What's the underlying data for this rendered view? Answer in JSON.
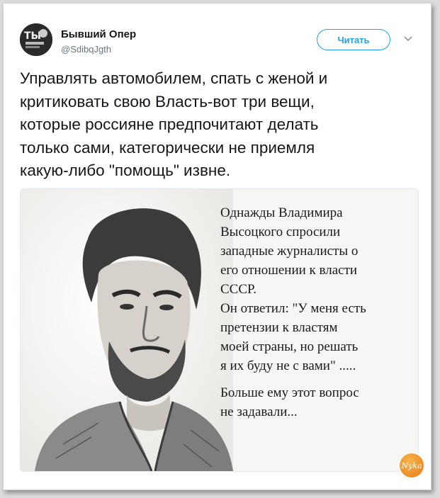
{
  "author": {
    "name": "Бывший Опер",
    "handle": "@SdibqJgth",
    "avatar_icon": "avatar-logo-icon"
  },
  "follow_label": "Читать",
  "menu_icon": "chevron-down-icon",
  "tweet_text": "Управлять автомобилем, спать с женой и\nкритиковать свою Власть-вот три вещи,\nкоторые россияне предпочитают делать\nтолько сами, категорически не приемля\nкакую-либо \"помощь\" извне.",
  "media": {
    "quote_lines_1": "Однажды Владимира\nВысоцкого спросили\nзападные журналисты о\nего отношении к власти\nСССР.\nОн ответил: \"У меня есть\nпретензии к властям\nмоей страны, но решать\nя их буду не с вами\" .....",
    "quote_lines_2": "Больше ему этот вопрос\nне задавали..."
  },
  "watermark_text": "Nyka",
  "colors": {
    "accent": "#1da1f2",
    "text": "#14171a",
    "secondary": "#657786",
    "watermark": "#e8831d"
  }
}
